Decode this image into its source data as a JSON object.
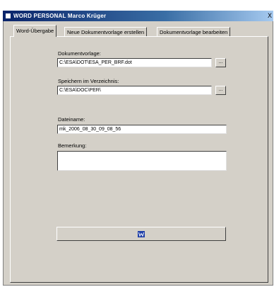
{
  "window": {
    "title": "WORD   PERSONAL   Marco Krüger",
    "close_glyph": "X"
  },
  "tabs": [
    {
      "label": "Word-Übergabe",
      "active": true
    },
    {
      "label": "Neue Dokumentvorlage erstellen",
      "active": false
    },
    {
      "label": "Dokumentvorlage bearbeiten",
      "active": false
    }
  ],
  "form": {
    "template_label": "Dokumentvorlage:",
    "template_value": "C:\\ESA\\DOT\\ESA_PER_BRF.dot",
    "save_dir_label": "Speichern im Verzeichnis:",
    "save_dir_value": "C:\\ESA\\DOC\\PER\\",
    "filename_label": "Dateiname:",
    "filename_value": "mk_2006_08_30_09_08_56",
    "remark_label": "Bemerkung:",
    "remark_value": "",
    "browse_label": "..."
  },
  "action_button": {
    "icon": "word-icon"
  }
}
